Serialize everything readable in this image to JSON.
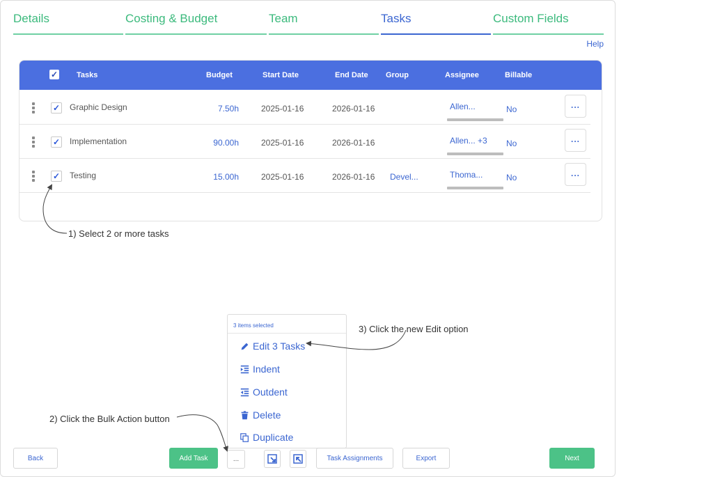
{
  "tabs": [
    {
      "label": "Details"
    },
    {
      "label": "Costing & Budget"
    },
    {
      "label": "Team"
    },
    {
      "label": "Tasks"
    },
    {
      "label": "Custom Fields"
    }
  ],
  "help_label": "Help",
  "table": {
    "columns": [
      "Tasks",
      "Budget",
      "Start Date",
      "End Date",
      "Group",
      "Assignee",
      "Billable"
    ],
    "header_checkbox": "✓",
    "rows": [
      {
        "checked": "✓",
        "name": "Graphic Design",
        "budget": "7.50h",
        "start": "2025-01-16",
        "end": "2026-01-16",
        "group": "",
        "assignee": "Allen...",
        "billable": "No",
        "menu": "..."
      },
      {
        "checked": "✓",
        "name": "Implementation",
        "budget": "90.00h",
        "start": "2025-01-16",
        "end": "2026-01-16",
        "group": "",
        "assignee": "Allen... +3",
        "billable": "No",
        "menu": "..."
      },
      {
        "checked": "✓",
        "name": "Testing",
        "budget": "15.00h",
        "start": "2025-01-16",
        "end": "2026-01-16",
        "group": "Devel...",
        "assignee": "Thoma...",
        "billable": "No",
        "menu": "..."
      }
    ]
  },
  "annotations": {
    "step1": "1) Select 2 or more tasks",
    "step2": "2) Click the Bulk Action button",
    "step3": "3) Click the new Edit option"
  },
  "dropdown": {
    "header": "3 items selected",
    "items": [
      {
        "label": "Edit 3 Tasks",
        "icon": "pencil-icon"
      },
      {
        "label": "Indent",
        "icon": "indent-icon"
      },
      {
        "label": "Outdent",
        "icon": "outdent-icon"
      },
      {
        "label": "Delete",
        "icon": "trash-icon"
      },
      {
        "label": "Duplicate",
        "icon": "copy-icon"
      }
    ]
  },
  "footer": {
    "back": "Back",
    "add_task": "Add Task",
    "bulk": "...",
    "task_assignments": "Task Assignments",
    "export": "Export",
    "next": "Next"
  },
  "colors": {
    "accent_blue": "#3b66d1",
    "header_blue": "#4b6fe0",
    "green": "#4cc287"
  }
}
